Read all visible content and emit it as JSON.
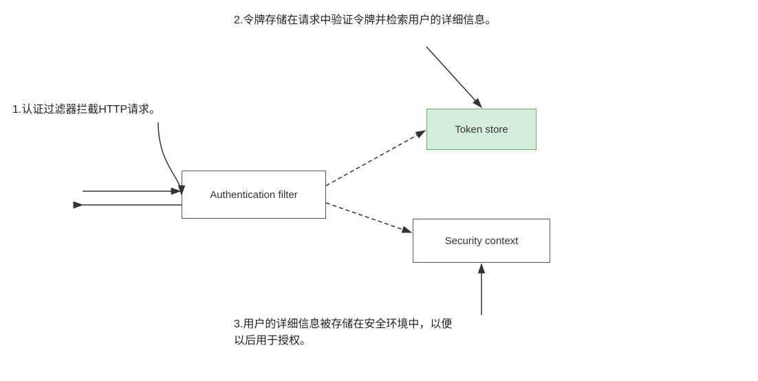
{
  "labels": {
    "label1": "1.认证过滤器拦截HTTP请求。",
    "label2": "2.令牌存储在请求中验证令牌并检索用户的详细信息。",
    "label3": "3.用户的详细信息被存储在安全环境中，以便\n以后用于授权。"
  },
  "boxes": {
    "auth_filter": "Authentication filter",
    "token_store": "Token store",
    "security_context": "Security context"
  },
  "colors": {
    "green_bg": "#d4edda",
    "green_border": "#6aaa6a",
    "box_border": "#555",
    "arrow": "#333"
  }
}
